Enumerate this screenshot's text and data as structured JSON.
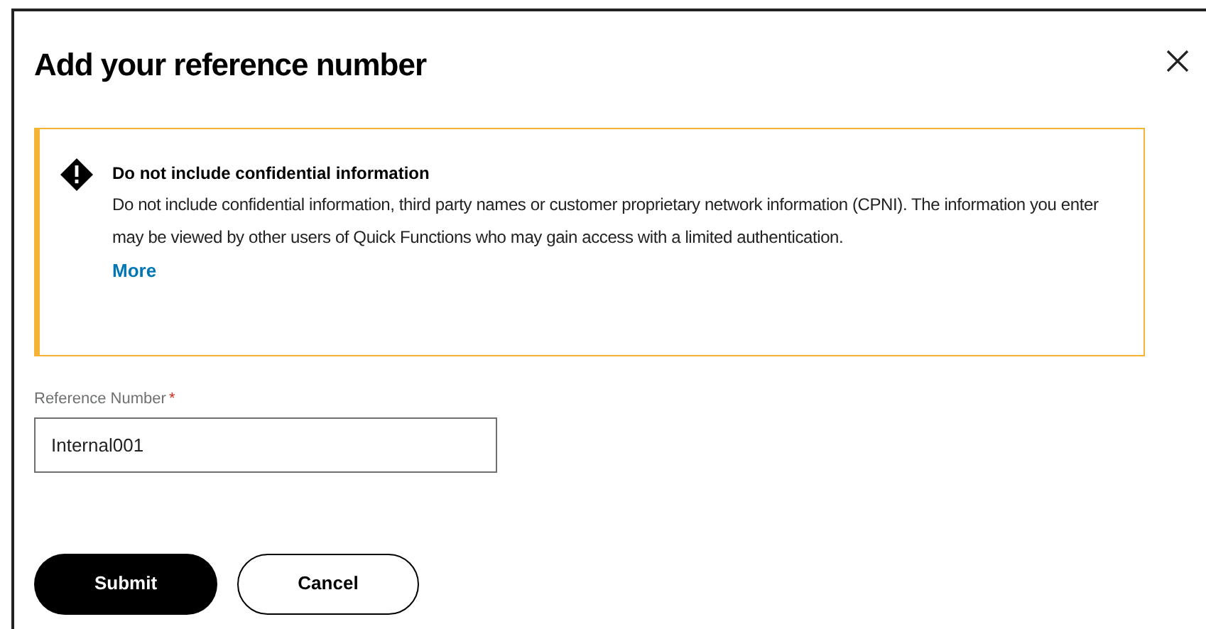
{
  "dialog": {
    "title": "Add your reference number",
    "alert": {
      "title": "Do not include confidential information",
      "body": "Do not include confidential information, third party names or customer proprietary network information (CPNI). The information you enter may be viewed by other users of Quick Functions who may gain access with a limited authentication.",
      "link": "More"
    },
    "field": {
      "label": "Reference Number",
      "required_mark": "*",
      "value": "Internal001"
    },
    "buttons": [
      {
        "label": "Submit",
        "kind": "primary"
      },
      {
        "label": "Cancel",
        "kind": "secondary"
      }
    ]
  }
}
